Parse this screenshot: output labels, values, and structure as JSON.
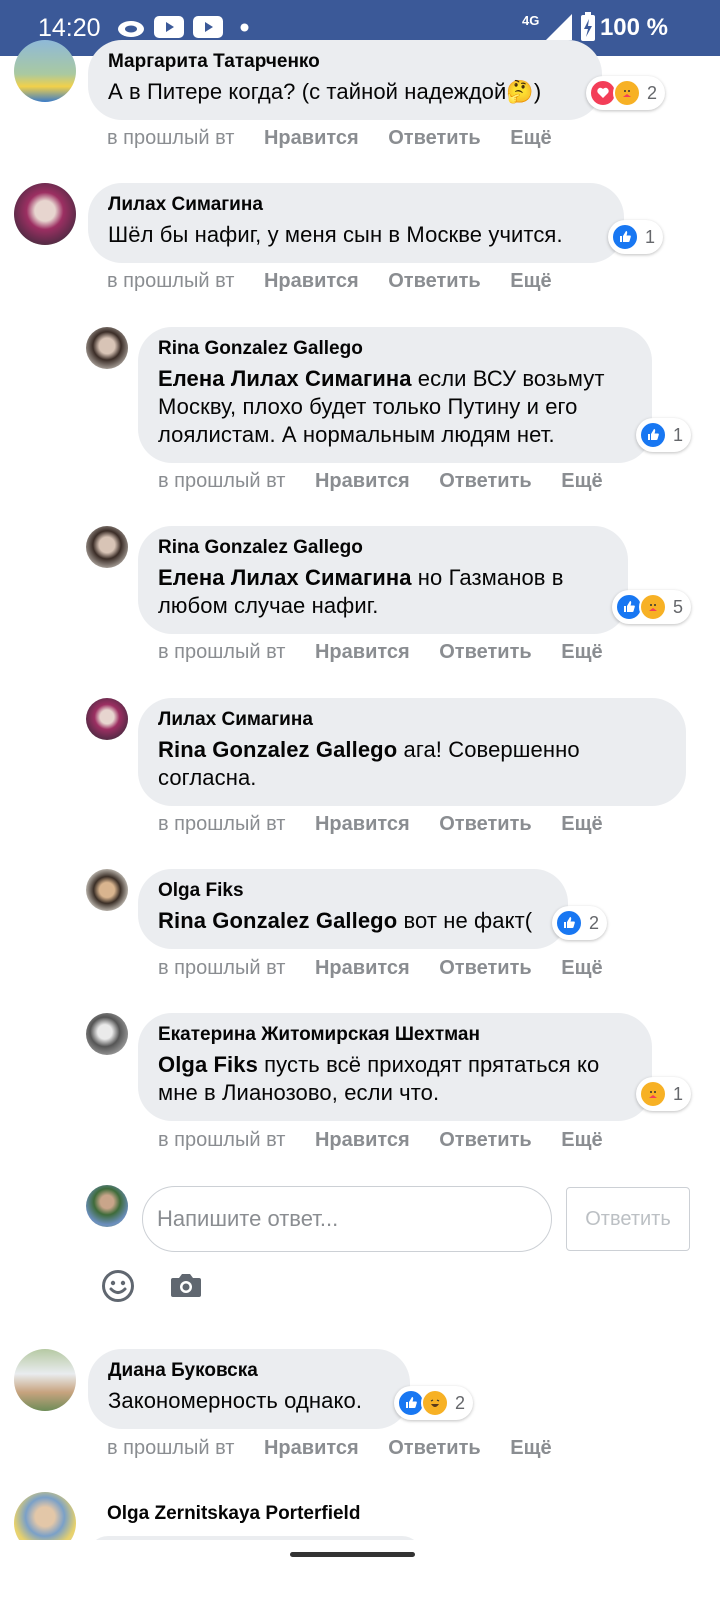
{
  "status_bar": {
    "time": "14:20",
    "network": "4G",
    "battery": "100 %",
    "icons": [
      "cloud-icon",
      "youtube-icon",
      "youtube-icon",
      "dot-icon",
      "signal-icon",
      "battery-charging-icon"
    ]
  },
  "meta_labels": {
    "time": "в прошлый вт",
    "like": "Нравится",
    "reply": "Ответить",
    "more": "Ещё"
  },
  "comments": [
    {
      "author": "Маргарита Татарченко",
      "text": "А в Питере когда? (с тайной надеждой🤔)",
      "reactions": [
        "love",
        "care"
      ],
      "reaction_count": "2"
    },
    {
      "author": "Лилах Симагина",
      "text": "Шёл бы нафиг, у меня сын в Москве учится.",
      "reactions": [
        "like"
      ],
      "reaction_count": "1"
    },
    {
      "author": "Rina Gonzalez Gallego",
      "mention": "Елена Лилах Симагина",
      "text": " если ВСУ возьмут Москву, плохо будет только Путину и его лоялистам. А нормальным людям нет.",
      "reactions": [
        "like"
      ],
      "reaction_count": "1"
    },
    {
      "author": "Rina Gonzalez Gallego",
      "mention": "Елена Лилах Симагина",
      "text": " но Газманов в любом случае нафиг.",
      "reactions": [
        "like",
        "care"
      ],
      "reaction_count": "5"
    },
    {
      "author": "Лилах Симагина",
      "mention": "Rina Gonzalez Gallego",
      "text": " ага! Совершенно согласна.",
      "reactions": [],
      "reaction_count": ""
    },
    {
      "author": "Olga Fiks",
      "mention": "Rina Gonzalez Gallego",
      "text": " вот не факт(",
      "reactions": [
        "like"
      ],
      "reaction_count": "2"
    },
    {
      "author": "Екатерина Житомирская Шехтман",
      "mention": "Olga Fiks",
      "text": " пусть всё приходят прятаться ко мне в Лианозово, если что.",
      "reactions": [
        "care"
      ],
      "reaction_count": "1"
    },
    {
      "author": "Диана Буковска",
      "text": "Закономерность однако.",
      "reactions": [
        "like",
        "haha"
      ],
      "reaction_count": "2"
    },
    {
      "author": "Olga Zernitskaya Porterfield",
      "text": ""
    }
  ],
  "reply_box": {
    "placeholder": "Напишите ответ...",
    "submit_label": "Ответить"
  },
  "colors": {
    "status_bar": "#3b5998",
    "bubble": "#ebedf0",
    "meta_text": "#8a8d91",
    "like_blue": "#1877f2",
    "love_red": "#f33e58",
    "emoji_yellow": "#f7b125"
  }
}
